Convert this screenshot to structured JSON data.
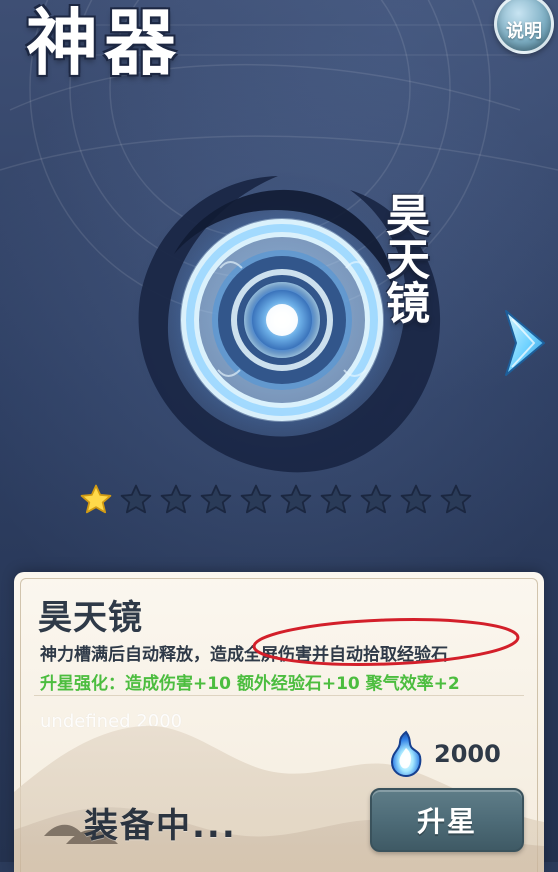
{
  "header": {
    "title": "神器",
    "help_label": "说明"
  },
  "artifact": {
    "name": "昊天镜",
    "stars_total": 10,
    "stars_filled": 1
  },
  "panel": {
    "title": "昊天镜",
    "description": "神力槽满后自动释放，造成全屏伤害并自动拾取经验石",
    "upgrade_effect": "升星强化：造成伤害+10 额外经验石+10 聚气效率+2",
    "debug_cost_text": "undefined 2000",
    "cost_value": "2000",
    "equipped_label": "装备中...",
    "upgrade_button_label": "升星"
  },
  "colors": {
    "background": "#2e3f63",
    "panel_bg": "#fbf7ef",
    "green_text": "#4cbd3f",
    "button": "#4e6c78",
    "highlight_oval": "#d31f2a",
    "star_filled": "#ffd94a",
    "star_empty": "#2a3b58"
  },
  "icons": {
    "help": "help-icon",
    "next": "chevron-right-icon",
    "cost": "flame-icon",
    "star": "star-icon"
  }
}
